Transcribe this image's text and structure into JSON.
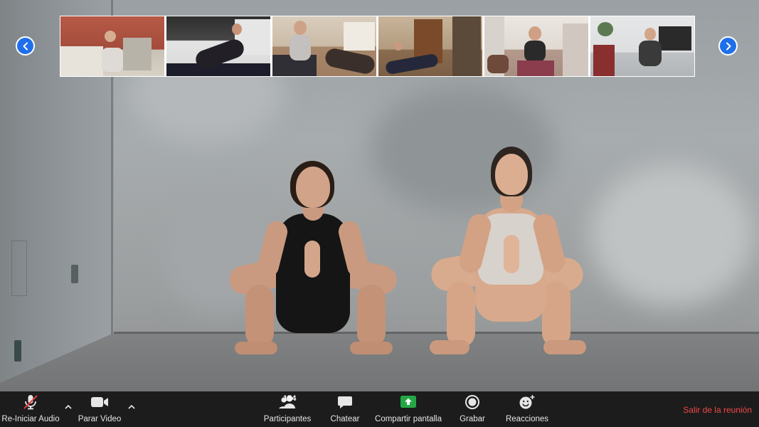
{
  "toolbar": {
    "audio_label": "Re-Iniciar Audio",
    "video_label": "Parar Video",
    "participants_label": "Participantes",
    "participants_count": "154",
    "chat_label": "Chatear",
    "share_label": "Compartir pantalla",
    "record_label": "Grabar",
    "reactions_label": "Reacciones",
    "leave_label": "Salir de la reunión"
  },
  "icons": {
    "prev": "chevron-left-icon",
    "next": "chevron-right-icon",
    "audio": "microphone-muted-icon",
    "video": "video-camera-icon",
    "participants": "people-icon",
    "chat": "chat-bubble-icon",
    "share": "share-screen-icon",
    "record": "record-icon",
    "reactions": "smiley-plus-icon"
  },
  "colors": {
    "toolbar_bg": "#1c1c1c",
    "accent_blue": "#1f6feb",
    "share_green": "#23a745",
    "leave_red": "#f04848",
    "muted_red": "#e23b3b"
  }
}
